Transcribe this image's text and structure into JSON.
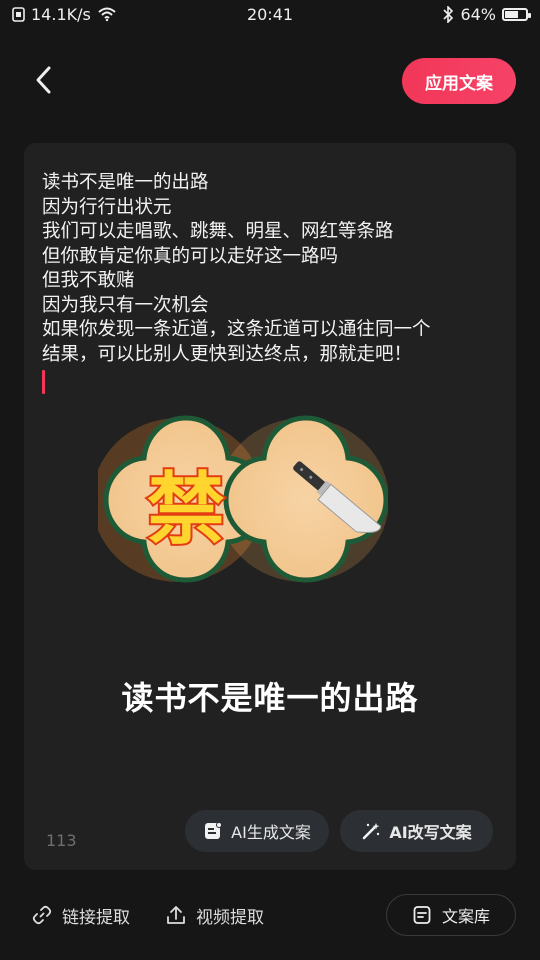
{
  "status_bar": {
    "network_speed": "14.1K/s",
    "time": "20:41",
    "battery": "64%",
    "battery_level": 0.64
  },
  "header": {
    "back_icon": "chevron-left-icon",
    "apply_button": "应用文案"
  },
  "editor": {
    "lines": [
      "读书不是唯一的出路",
      "因为行行出状元",
      "我们可以走唱歌、跳舞、明星、网红等条路",
      "但你敢肯定你真的可以走好这一路吗",
      "但我不敢赌",
      "因为我只有一次机会",
      "如果你发现一条近道，这条近道可以通往同一个",
      "结果，可以比别人更快到达终点，那就走吧！"
    ],
    "sticker_text": "禁",
    "caption": "读书不是唯一的出路",
    "char_count": "113",
    "ai_generate_label": "AI生成文案",
    "ai_rewrite_label": "AI改写文案"
  },
  "bottom_bar": {
    "link_extract_label": "链接提取",
    "video_extract_label": "视频提取",
    "library_label": "文案库"
  },
  "colors": {
    "accent": "#f23758",
    "background": "#161616",
    "card": "#212121"
  }
}
